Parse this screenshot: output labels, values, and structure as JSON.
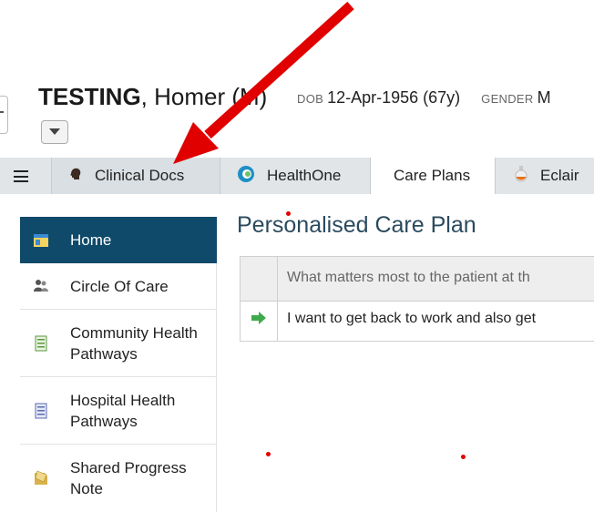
{
  "patient": {
    "surname": "TESTING",
    "given": ", Homer (M)",
    "dob_label": "DOB",
    "dob_value": "12-Apr-1956 (67y)",
    "gender_label": "GENDER",
    "gender_value": "M"
  },
  "tabs": [
    {
      "label": "Clinical Docs",
      "icon": "head-icon"
    },
    {
      "label": "HealthOne",
      "icon": "healthone-logo-icon"
    },
    {
      "label": "Care Plans",
      "icon": ""
    },
    {
      "label": "Eclair",
      "icon": "flask-icon"
    }
  ],
  "sidebar": {
    "items": [
      {
        "label": "Home",
        "icon": "home-icon"
      },
      {
        "label": "Circle Of Care",
        "icon": "people-icon"
      },
      {
        "label": "Community Health Pathways",
        "icon": "document-green-icon"
      },
      {
        "label": "Hospital Health Pathways",
        "icon": "document-blue-icon"
      },
      {
        "label": "Shared Progress Note",
        "icon": "note-icon"
      }
    ]
  },
  "content": {
    "title": "Personalised Care Plan",
    "table": {
      "header": "What matters most to the patient at th",
      "rows": [
        "I want to get back to work and also get"
      ]
    }
  },
  "colors": {
    "accent": "#0f4a6a",
    "annotation": "#e00000",
    "tabbar": "#e1e5e8"
  }
}
